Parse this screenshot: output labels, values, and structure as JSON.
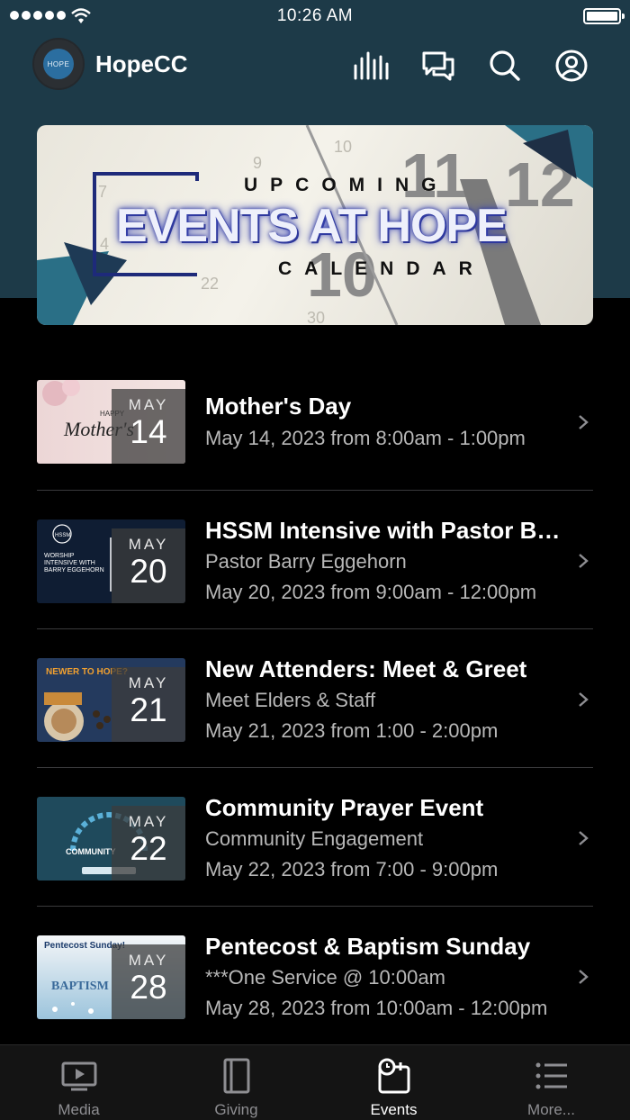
{
  "status_bar": {
    "time": "10:26 AM"
  },
  "header": {
    "avatar_text": "HOPE",
    "app_title": "HopeCC",
    "icons": [
      "audio-bars-icon",
      "chat-icon",
      "search-icon",
      "profile-icon"
    ]
  },
  "banner": {
    "line1": "UPCOMING",
    "line2": "EVENTS AT HOPE",
    "line3": "CALENDAR"
  },
  "events": [
    {
      "month": "MAY",
      "day": "14",
      "title": "Mother's Day",
      "subtitle": "",
      "when": "May 14, 2023 from 8:00am - 1:00pm"
    },
    {
      "month": "MAY",
      "day": "20",
      "title": "HSSM Intensive with Pastor Barry Eggehorn",
      "subtitle": "Pastor Barry Eggehorn",
      "when": "May 20, 2023 from 9:00am - 12:00pm"
    },
    {
      "month": "MAY",
      "day": "21",
      "title": "New Attenders: Meet & Greet",
      "subtitle": "Meet Elders & Staff",
      "when": "May 21, 2023 from 1:00 - 2:00pm"
    },
    {
      "month": "MAY",
      "day": "22",
      "title": "Community Prayer Event",
      "subtitle": "Community Engagement",
      "when": "May 22, 2023 from 7:00 - 9:00pm"
    },
    {
      "month": "MAY",
      "day": "28",
      "title": "Pentecost & Baptism Sunday",
      "subtitle": "***One Service @ 10:00am",
      "when": "May 28, 2023 from 10:00am - 12:00pm"
    }
  ],
  "tabs": [
    {
      "label": "Media",
      "icon": "media-icon",
      "active": false
    },
    {
      "label": "Giving",
      "icon": "giving-icon",
      "active": false
    },
    {
      "label": "Events",
      "icon": "events-icon",
      "active": true
    },
    {
      "label": "More...",
      "icon": "more-list-icon",
      "active": false
    }
  ],
  "colors": {
    "header_bg": "#1d3a48",
    "banner_navy": "#1e2a7a",
    "tab_active": "#ffffff",
    "tab_inactive": "#8e8e92"
  }
}
